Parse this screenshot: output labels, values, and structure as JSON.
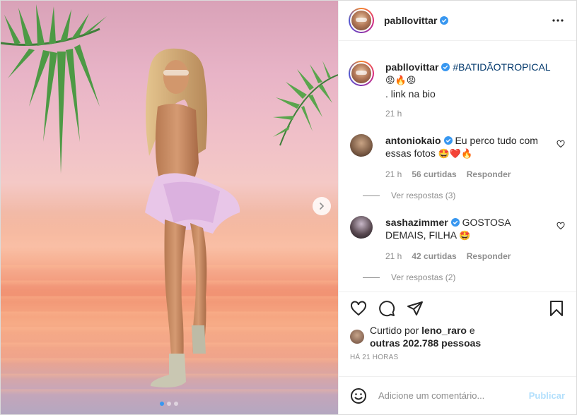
{
  "post": {
    "author": "pabllovittar",
    "caption_hashtag": "#BATIDÃOTROPICAL",
    "caption_emojis": "😡🔥😡",
    "caption_line2": ". link na bio",
    "caption_time": "21 h"
  },
  "comments": [
    {
      "username": "antoniokaio",
      "text": "Eu perco tudo com essas fotos",
      "emojis": "🤩❤️🔥",
      "time": "21 h",
      "likes": "56 curtidas",
      "reply": "Responder",
      "view_replies": "Ver respostas (3)"
    },
    {
      "username": "sashazimmer",
      "text": "GOSTOSA DEMAIS, FILHA",
      "emojis": "🤩",
      "time": "21 h",
      "likes": "42 curtidas",
      "reply": "Responder",
      "view_replies": "Ver respostas (2)"
    }
  ],
  "likes": {
    "prefix": "Curtido por",
    "user": "leno_raro",
    "connector": "e",
    "others": "outras 202.788 pessoas"
  },
  "timestamp": "Há 21 horas",
  "add_comment": {
    "placeholder": "Adicione um comentário...",
    "publish_label": "Publicar"
  },
  "icons": {
    "more": "more-options-icon",
    "verified": "verified-badge-icon",
    "like": "heart-icon",
    "comment": "comment-bubble-icon",
    "share": "paper-plane-icon",
    "save": "bookmark-icon",
    "emoji": "smiley-icon",
    "next": "chevron-right-icon"
  },
  "colors": {
    "verified_blue": "#3897f0",
    "hashtag": "#00376b",
    "muted": "#8e8e8e",
    "publish_disabled": "#b2dffc"
  }
}
